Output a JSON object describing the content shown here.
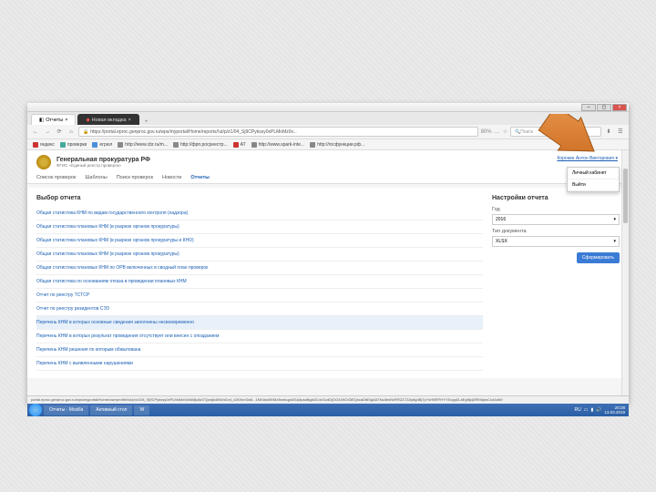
{
  "browser": {
    "tabs": [
      {
        "label": "Отчеты",
        "active": true
      },
      {
        "label": "Новая вкладка",
        "dark": true
      }
    ],
    "url": "https://portal.eproc.genproc.gov.ru/wps/myportal/Home/reports/!ut/p/z1/04_Sj9CPykssy0xPLMnMz0v...",
    "search_placeholder": "Поиск",
    "url_pct": "80%",
    "bookmarks": [
      "яндекс",
      "проверки",
      "егрюл",
      "http://www.cbr.ru/m...",
      "http://фрп.росреестр...",
      "АТ",
      "http://www.spark-inte...",
      "http://госфункции.рф..."
    ]
  },
  "page": {
    "org_title": "Генеральная прокуратура РФ",
    "org_sub": "ФГИС «Единый реестр проверок»",
    "user_name": "Корокин Антон Викторович",
    "user_menu": [
      "Личный кабинет",
      "Выйти"
    ],
    "nav": [
      "Список проверок",
      "Шаблоны",
      "Поиск проверок",
      "Новости",
      "Отчеты"
    ],
    "nav_active": "Отчеты",
    "left_title": "Выбор отчета",
    "reports": [
      "Общая статистика КНМ по видам государственного контроля (надзора)",
      "Общая статистика плановых КНМ (в разрезе органов прокуратуры)",
      "Общая статистика плановых КНМ (в разрезе органов прокуратуры и КНО)",
      "Общая статистика плановых КНМ (в разрезе органов прокуратуры)",
      "Общая статистика плановых КНМ по ОРВ включенных в сводный план проверок",
      "Общая статистика по основаниям отказа в проведении плановых КНМ",
      "Отчет по реестру ТСТСР",
      "Отчет по реестру резидентов СЭЗ",
      "Перечень КНМ в которых основные сведения заполнены несвоевременно",
      "Перечень КНМ в которых результат проведения отсутствует или внесен с опозданием",
      "Перечень КНМ решения по которым обжалована",
      "Перечень КНМ с выявленными нарушениями"
    ],
    "highlighted_index": 8,
    "right_title": "Настройки отчета",
    "year_label": "Год",
    "year_value": "2016",
    "doctype_label": "Тип документа",
    "doctype_value": "XLSX",
    "generate_btn": "Сформировать"
  },
  "statusbar": "portal.eproc.genproc.gov.ru/wps/myportal/Home/userprofile/!ut/p/z1/04_Sj9CPykssy0xPLMnMz0vMAfljo8zi7QwdjIc8N0nDvd_c28XecSw8...1MXAwM0Mz3wekqpAfGa3paaBgA6CdcGzdDjOG44NO43EQscaDt8SgAATNzAfwNxRRZZ7ZAy8g4Bj7pYsHBRFHYYEogqI3-aEgNjqDRMIqIwCu44aW/",
  "taskbar": {
    "apps": [
      "Отчеты - Mozilla",
      "Активный стол",
      "W"
    ],
    "lang": "RU",
    "time": "20:28",
    "date": "13.03.2019"
  },
  "chart_data": null
}
